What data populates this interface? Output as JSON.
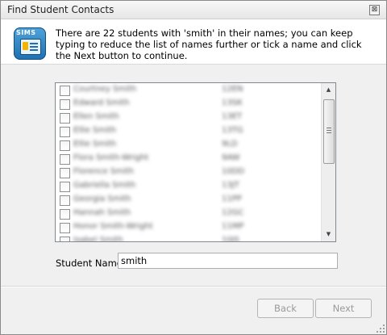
{
  "window": {
    "title": "Find Student Contacts",
    "close_glyph": "⊠"
  },
  "banner": {
    "icon": "sims-app-icon",
    "icon_text": "SIMS",
    "message": "There are 22 students with 'smith' in their names; you can keep typing to reduce the list of names further or tick a name and click the Next button to continue."
  },
  "students": [
    {
      "name": "Courtney Smith",
      "code": "12EN"
    },
    {
      "name": "Edward Smith",
      "code": "13SK"
    },
    {
      "name": "Ellen Smith",
      "code": "13ET"
    },
    {
      "name": "Ellie Smith",
      "code": "13TG"
    },
    {
      "name": "Ellie Smith",
      "code": "9LD"
    },
    {
      "name": "Flora Smith-Wright",
      "code": "9AW"
    },
    {
      "name": "Florence Smith",
      "code": "10DD"
    },
    {
      "name": "Gabriella Smith",
      "code": "13JT"
    },
    {
      "name": "Georgia Smith",
      "code": "11PP"
    },
    {
      "name": "Hannah Smith",
      "code": "12GC"
    },
    {
      "name": "Honor Smith-Wright",
      "code": "11MP"
    },
    {
      "name": "Isabel Smith",
      "code": "10JS"
    }
  ],
  "search": {
    "label": "Student Name:",
    "value": "smith"
  },
  "buttons": {
    "back": "Back",
    "next": "Next"
  },
  "colors": {
    "banner_bg": "#ffffff",
    "window_bg": "#f0f0f0",
    "icon_blue": "#1f6fb2"
  }
}
